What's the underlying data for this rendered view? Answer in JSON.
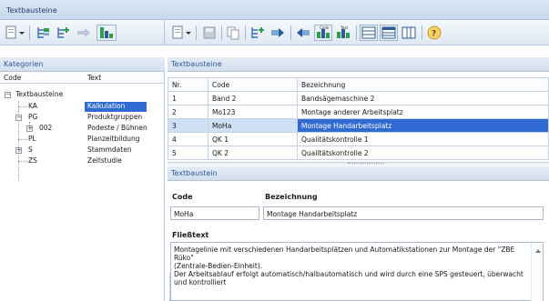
{
  "window": {
    "title": "Textbausteine"
  },
  "categories_panel": {
    "title": "Kategorien",
    "columns": [
      "Code",
      "Text"
    ],
    "tree": [
      {
        "code": "Textbausteine",
        "text": ""
      },
      {
        "code": "KA",
        "text": "Kalkulation"
      },
      {
        "code": "PG",
        "text": "Produktgruppen"
      },
      {
        "code": "002",
        "text": "Podeste / Bühnen"
      },
      {
        "code": "PL",
        "text": "Planzeitbildung"
      },
      {
        "code": "S",
        "text": "Stammdaten"
      },
      {
        "code": "ZS",
        "text": "Zeitstudie"
      }
    ]
  },
  "textbausteine_panel": {
    "title": "Textbausteine",
    "columns": [
      "Nr.",
      "Code",
      "Bezeichnung"
    ],
    "rows": [
      {
        "nr": "1",
        "code": "Band 2",
        "bezeichnung": "Bandsägemaschine 2"
      },
      {
        "nr": "2",
        "code": "Mo123",
        "bezeichnung": "Montage anderer Arbeitsplatz"
      },
      {
        "nr": "3",
        "code": "MoHa",
        "bezeichnung": "Montage Handarbeitsplatz"
      },
      {
        "nr": "4",
        "code": "QK 1",
        "bezeichnung": "Qualitätskontrolle 1"
      },
      {
        "nr": "5",
        "code": "QK 2",
        "bezeichnung": "Qualitätskontrolle 2"
      }
    ]
  },
  "detail_panel": {
    "title": "Textbaustein",
    "code_label": "Code",
    "code_value": "MoHa",
    "bezeichnung_label": "Bezeichnung",
    "bezeichnung_value": "Montage Handarbeitsplatz",
    "fliesstext_label": "Fließtext",
    "fliesstext_lines": [
      "Montagelinie mit verschiedenen Handarbeitsplätzen und Automatikstationen zur Montage der \"ZBE Rüko\"",
      "(Zentrale-Bedien-Einheit).",
      "Der Arbeitsablauf erfolgt automatisch/halbautomatisch und wird durch eine SPS gesteuert, überwacht",
      "und kontrolliert"
    ]
  },
  "toolbar_icons": {
    "left": [
      "new-dropdown-icon",
      "add-category-icon",
      "add-subcategory-icon",
      "move-right-icon",
      "tree-view-icon"
    ],
    "right": [
      "new-dropdown-icon",
      "save-icon",
      "copy-icon",
      "add-icon",
      "insert-icon",
      "delete-icon",
      "code-column-icon",
      "text-column-icon",
      "grid-view-icon",
      "table-view-icon",
      "columns-icon",
      "help-icon"
    ],
    "text_labels": {
      "code_icon": "Code",
      "text_icon": "Text"
    }
  },
  "colors": {
    "selection": "#2f6bd2",
    "panel_header_text": "#2b5c98",
    "accent_green": "#2e9e4a"
  }
}
